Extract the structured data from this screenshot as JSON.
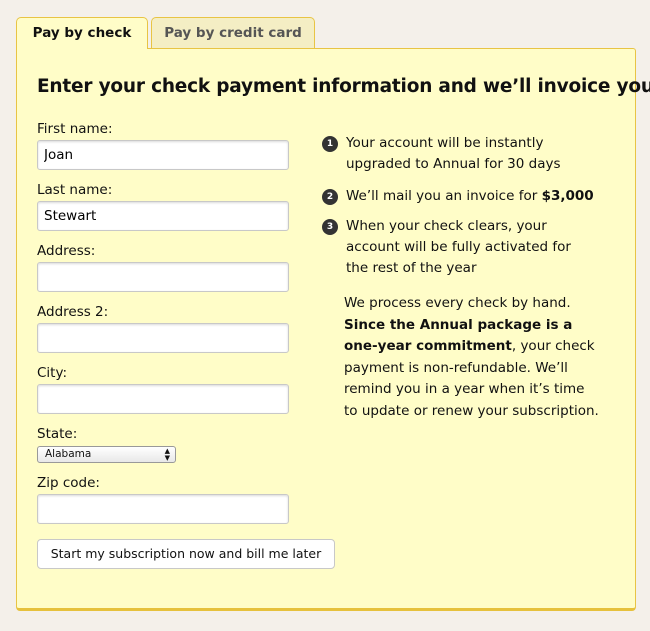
{
  "tabs": [
    {
      "label": "Pay by check",
      "active": true
    },
    {
      "label": "Pay by credit card",
      "active": false
    }
  ],
  "heading": "Enter your check payment information and we’ll invoice you",
  "form": {
    "first_name": {
      "label": "First name:",
      "value": "Joan"
    },
    "last_name": {
      "label": "Last name:",
      "value": "Stewart"
    },
    "address": {
      "label": "Address:",
      "value": ""
    },
    "address2": {
      "label": "Address 2:",
      "value": ""
    },
    "city": {
      "label": "City:",
      "value": ""
    },
    "state": {
      "label": "State:",
      "value": "Alabama"
    },
    "zip": {
      "label": "Zip code:",
      "value": ""
    },
    "submit_label": "Start my subscription now and bill me later"
  },
  "steps": [
    {
      "num": "1",
      "text": "Your account will be instantly upgraded to Annual for 30 days"
    },
    {
      "num": "2",
      "text": "We’ll mail you an invoice for ",
      "bold": "$3,000"
    },
    {
      "num": "3",
      "text": "When your check clears, your account will be fully activated for the rest of the year"
    }
  ],
  "note": {
    "pre": "We process every check by hand. ",
    "bold": "Since the Annual package is a one-year commitment",
    "post": ", your check payment is non-refundable. We’ll remind you in a year when it’s time to update or renew your subscription."
  }
}
